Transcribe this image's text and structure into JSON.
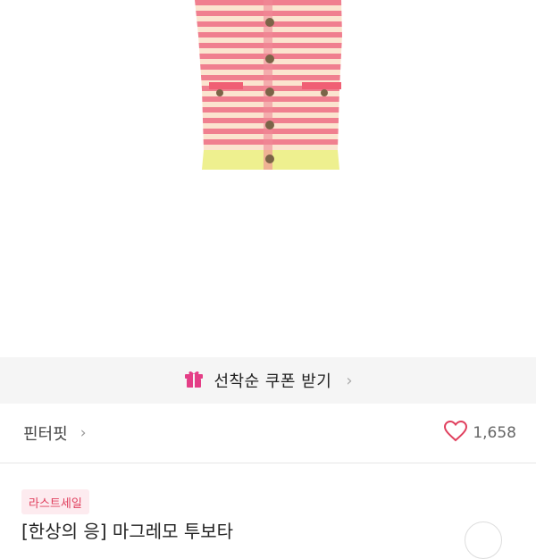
{
  "product": {
    "image_alt": "pink and yellow striped knit cardigan"
  },
  "coupon": {
    "icon": "gift-icon",
    "label": "선착순 쿠폰 받기"
  },
  "brand": {
    "name": "핀터핏",
    "likes": "1,658"
  },
  "badge": {
    "label": "라스트세일"
  },
  "product_title": {
    "text": "[한상의 응] 마그레모 투보타"
  },
  "colors": {
    "accent_pink": "#e0405e",
    "coupon_bg": "#f5f5f5",
    "badge_bg": "#fdebef"
  }
}
